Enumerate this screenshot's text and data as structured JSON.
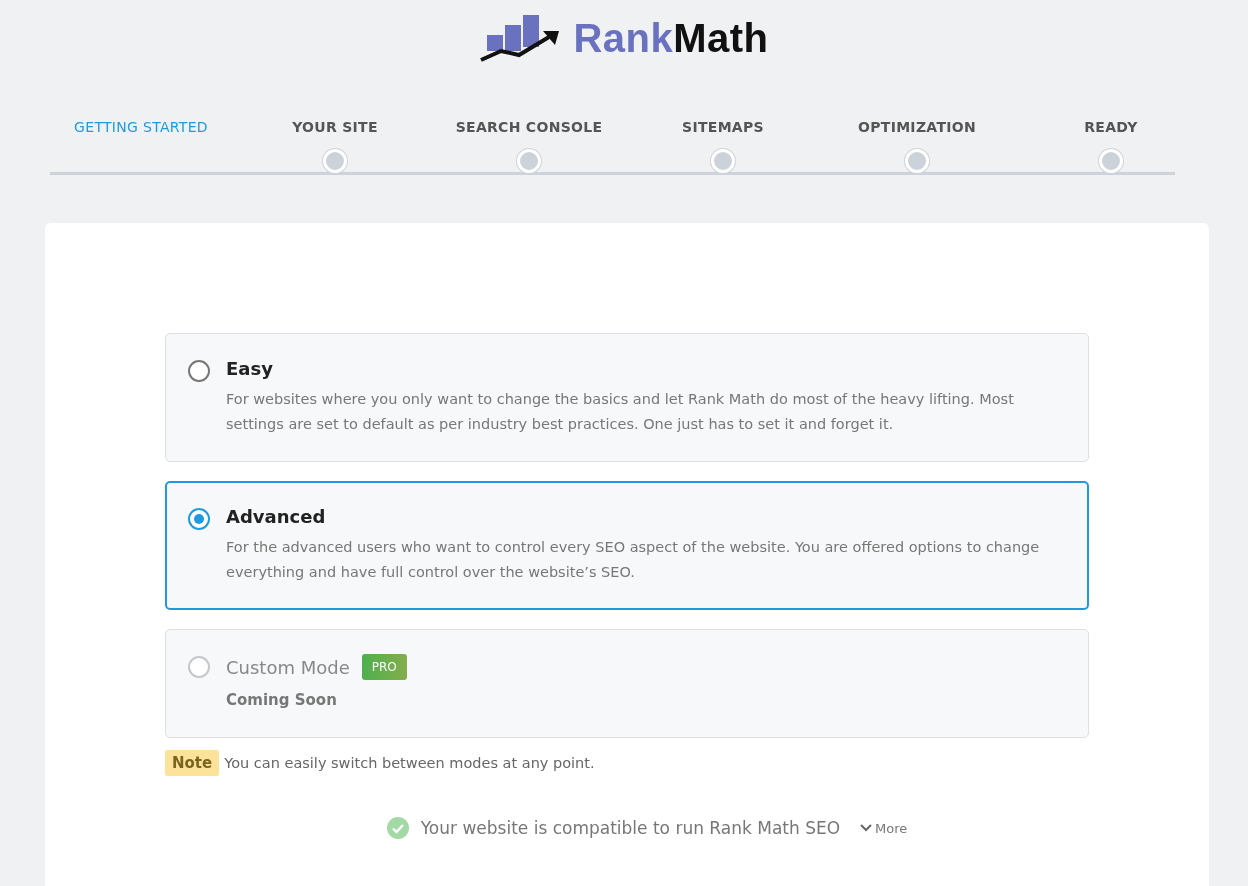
{
  "logo": {
    "brand": "Rank",
    "suffix": "Math"
  },
  "steps": [
    {
      "label": "GETTING STARTED",
      "selected": true
    },
    {
      "label": "YOUR SITE",
      "selected": false
    },
    {
      "label": "SEARCH CONSOLE",
      "selected": false
    },
    {
      "label": "SITEMAPS",
      "selected": false
    },
    {
      "label": "OPTIMIZATION",
      "selected": false
    },
    {
      "label": "READY",
      "selected": false
    }
  ],
  "modes": [
    {
      "title": "Easy",
      "description": "For websites where you only want to change the basics and let Rank Math do most of the heavy lifting. Most settings are set to default as per industry best practices. One just has to set it and forget it.",
      "selected": false,
      "disabled": false
    },
    {
      "title": "Advanced",
      "description": "For the advanced users who want to control every SEO aspect of the website. You are offered options to change everything and have full control over the website’s SEO.",
      "selected": true,
      "disabled": false
    },
    {
      "title": "Custom Mode",
      "badge": "PRO",
      "description": "Coming Soon",
      "selected": false,
      "disabled": true
    }
  ],
  "note": {
    "label": "Note",
    "text": "You can easily switch between modes at any point."
  },
  "compatibility": {
    "text": "Your website is compatible to run Rank Math SEO",
    "more": "More"
  }
}
